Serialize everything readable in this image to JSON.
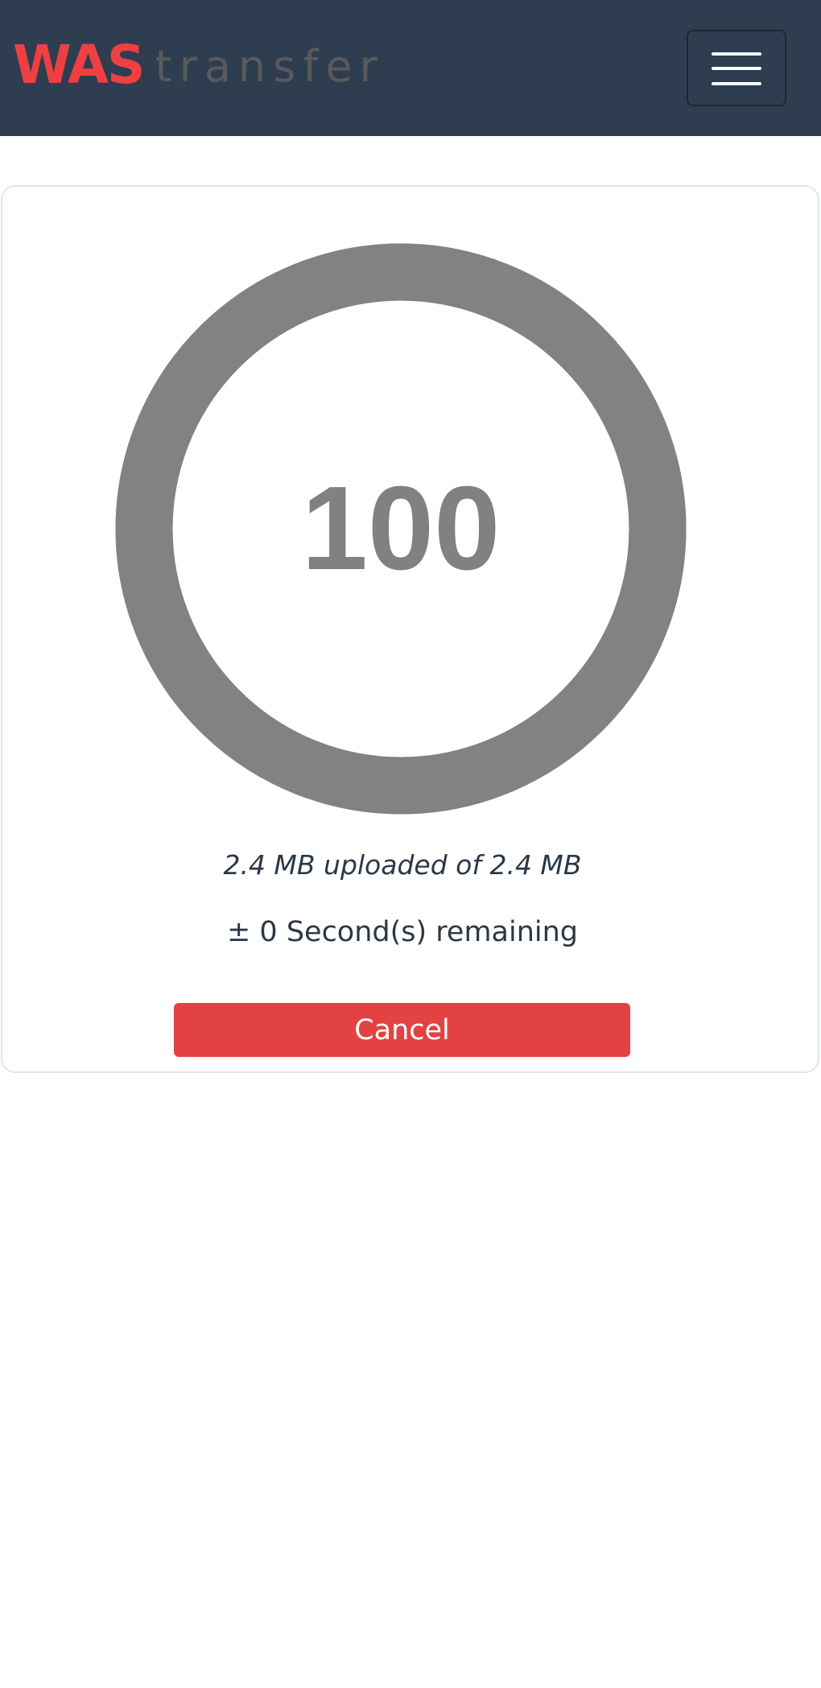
{
  "navbar": {
    "brand": {
      "logo_text": "WAS",
      "sub_text": "transfer",
      "logo_color": "#ef3f42",
      "sub_color": "#5a5a5a"
    },
    "background_color": "#2e3d50",
    "menu_toggle_icon": "hamburger-menu-icon"
  },
  "upload": {
    "progress_percent": 100,
    "progress_label": "100",
    "ring_color": "#828282",
    "status_text": "2.4 MB uploaded of 2.4 MB",
    "time_remaining_text": "± 0 Second(s) remaining",
    "cancel_label": "Cancel",
    "cancel_color": "#e34242"
  }
}
